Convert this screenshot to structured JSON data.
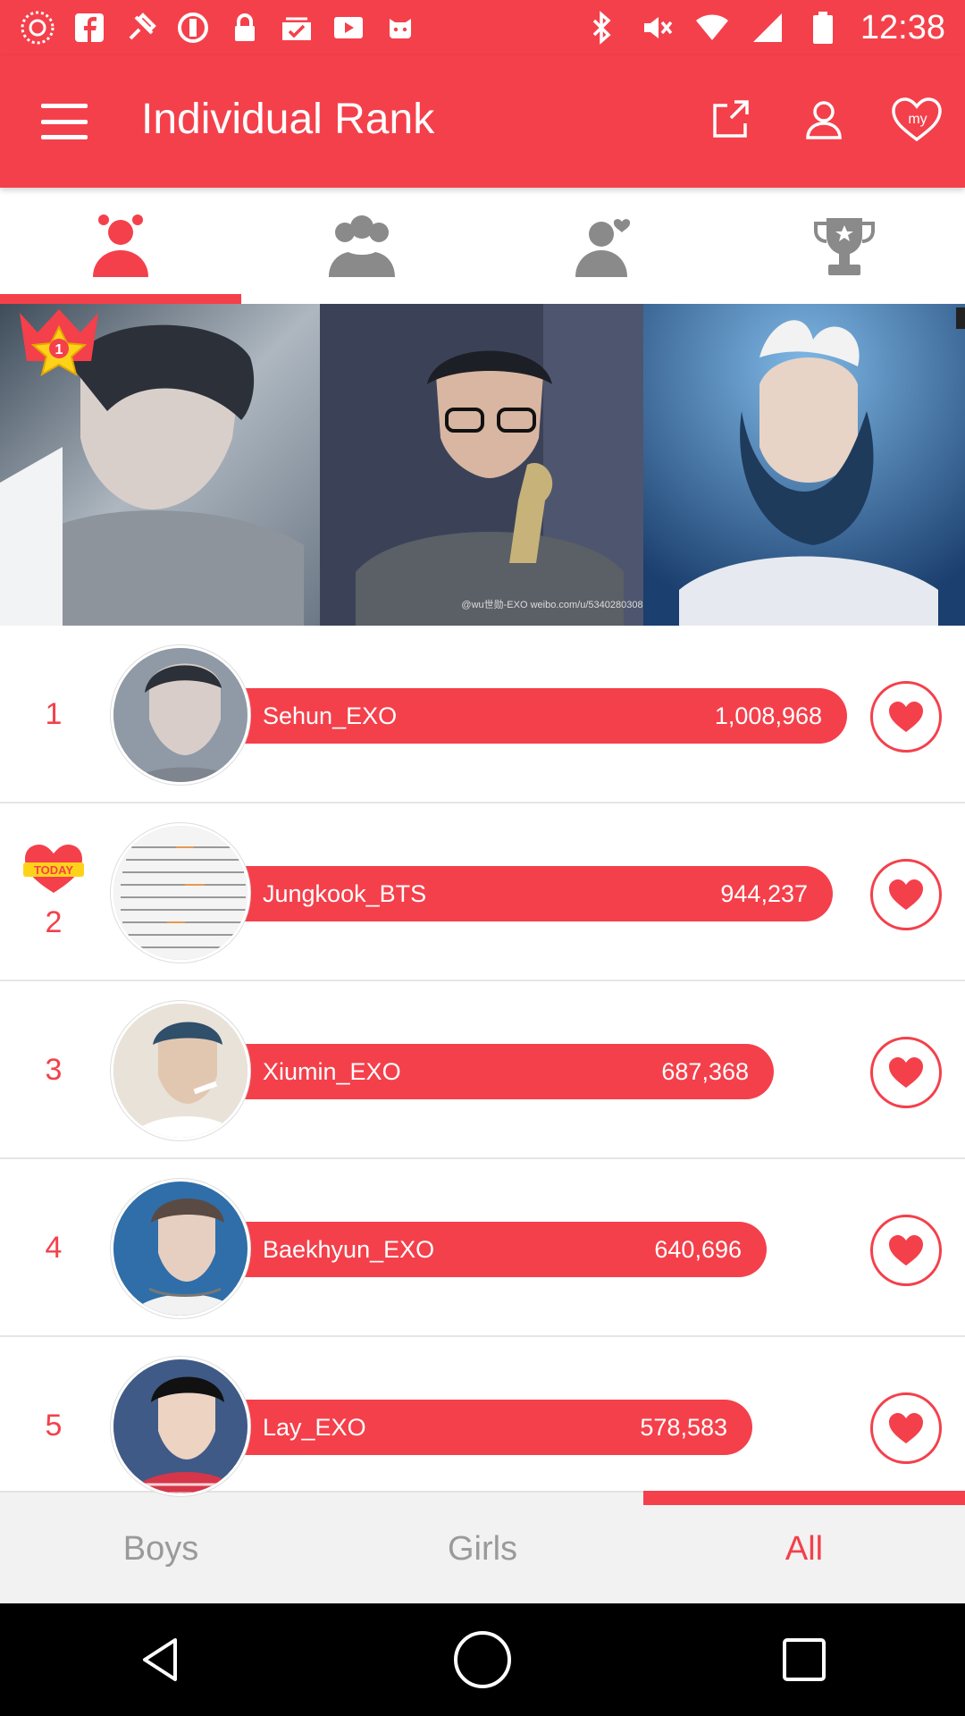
{
  "status_bar": {
    "time": "12:38",
    "left_icons": [
      "aperture-icon",
      "facebook-icon",
      "fake-gps-icon",
      "blocked-icon",
      "lock-icon",
      "checklist-icon",
      "play-icon",
      "game-icon"
    ],
    "right_icons": [
      "bluetooth-icon",
      "mute-icon",
      "wifi-icon",
      "signal-icon",
      "battery-icon"
    ]
  },
  "header": {
    "title": "Individual Rank",
    "actions": [
      "share-icon",
      "profile-icon",
      "my-heart-icon"
    ],
    "my_badge": "my"
  },
  "category_tabs": [
    {
      "icon": "individual-icon",
      "active": true
    },
    {
      "icon": "group-icon",
      "active": false
    },
    {
      "icon": "couple-icon",
      "active": false
    },
    {
      "icon": "trophy-icon",
      "active": false
    }
  ],
  "banner": {
    "crown_rank": "1",
    "watermark": "@wu世勋-EXO weibo.com/u/5340280308"
  },
  "ranking": [
    {
      "rank": "1",
      "name": "Sehun_EXO",
      "votes": "1,008,968",
      "today": false
    },
    {
      "rank": "2",
      "name": "Jungkook_BTS",
      "votes": "944,237",
      "today": true,
      "today_label": "TODAY"
    },
    {
      "rank": "3",
      "name": "Xiumin_EXO",
      "votes": "687,368",
      "today": false
    },
    {
      "rank": "4",
      "name": "Baekhyun_EXO",
      "votes": "640,696",
      "today": false
    },
    {
      "rank": "5",
      "name": "Lay_EXO",
      "votes": "578,583",
      "today": false
    }
  ],
  "bottom_tabs": [
    {
      "label": "Boys",
      "active": false
    },
    {
      "label": "Girls",
      "active": false
    },
    {
      "label": "All",
      "active": true
    }
  ],
  "nav": [
    "back-icon",
    "home-icon",
    "recents-icon"
  ],
  "colors": {
    "accent": "#f4404b",
    "muted": "#9a9a9a"
  }
}
